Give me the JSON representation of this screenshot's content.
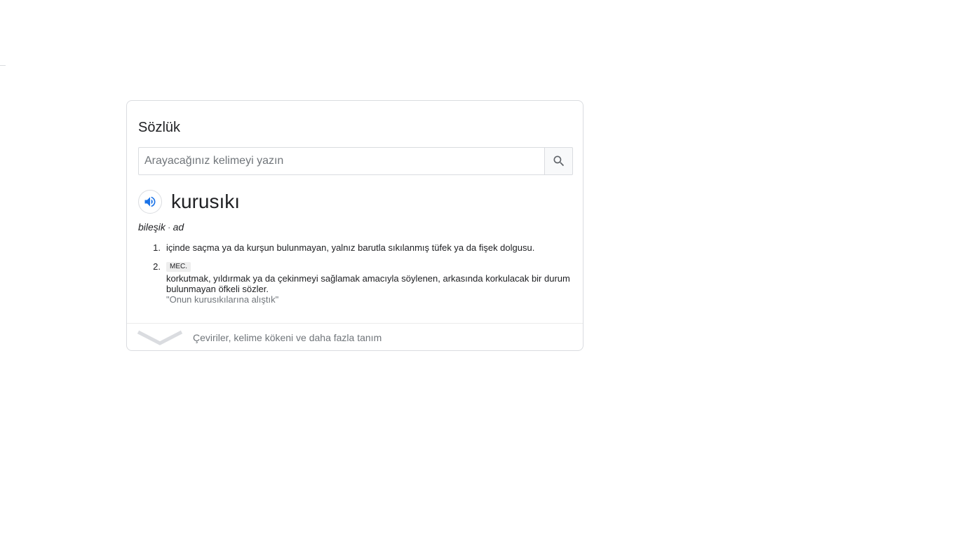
{
  "dictionary": {
    "title": "Sözlük",
    "search": {
      "placeholder": "Arayacağınız kelimeyi yazın",
      "value": "",
      "button_icon": "search-icon"
    },
    "entry": {
      "word": "kurusıkı",
      "audio_icon": "speaker-icon",
      "part_of_speech": [
        "bileşik",
        "ad"
      ],
      "definitions": [
        {
          "number": "1.",
          "text": "içinde saçma ya da kurşun bulunmayan, yalnız barutla sıkılanmış tüfek ya da fişek dolgusu."
        },
        {
          "number": "2.",
          "tag": "MEC.",
          "text": "korkutmak, yıldırmak ya da çekinmeyi sağlamak amacıyla söylenen, arkasında korkulacak bir durum bulunmayan öfkeli sözler.",
          "example": "\"Onun kurusıkılarına alıştık\""
        }
      ]
    },
    "footer": {
      "icon": "chevron-down-icon",
      "label": "Çeviriler, kelime kökeni ve daha fazla tanım"
    }
  },
  "colors": {
    "accent_blue": "#1a73e8",
    "text_primary": "#202124",
    "text_secondary": "#70757a",
    "border": "#dadce0"
  }
}
